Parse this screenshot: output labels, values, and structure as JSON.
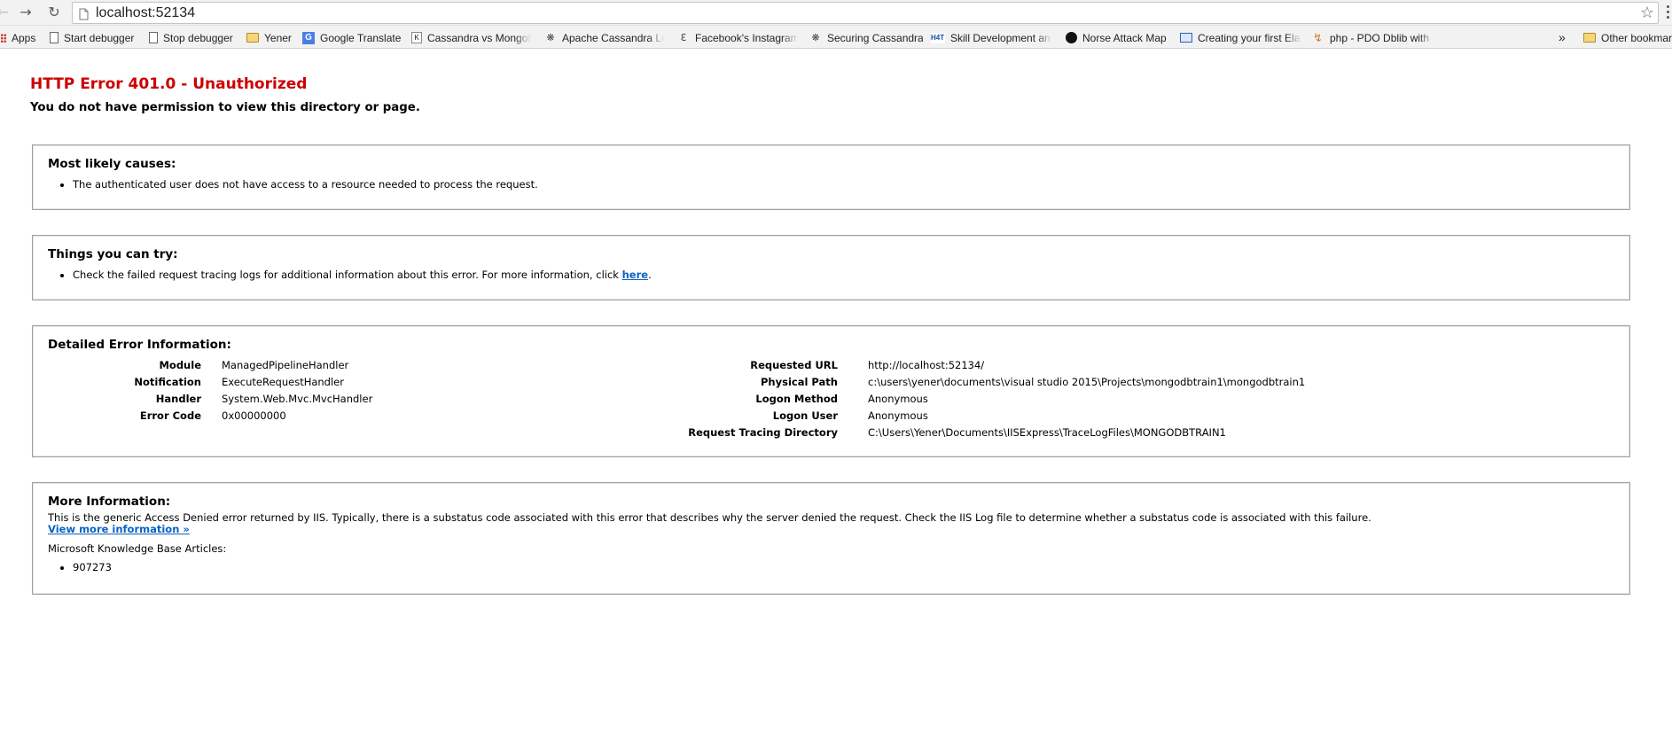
{
  "browser": {
    "address": "localhost:52134",
    "bookmarks": [
      {
        "label": "Apps",
        "icon": "apps-grid-icon"
      },
      {
        "label": "Start debugger",
        "icon": "page-icon"
      },
      {
        "label": "Stop debugger",
        "icon": "page-icon"
      },
      {
        "label": "Yener",
        "icon": "folder-icon"
      },
      {
        "label": "Google Translate",
        "icon": "google-translate-icon"
      },
      {
        "label": "Cassandra vs MongoD",
        "icon": "site-k-icon"
      },
      {
        "label": "Apache Cassandra Le",
        "icon": "cassandra-eye-icon"
      },
      {
        "label": "Facebook's Instagram",
        "icon": "site-e-icon"
      },
      {
        "label": "Securing Cassandra",
        "icon": "cassandra-eye-icon"
      },
      {
        "label": "Skill Development an",
        "icon": "h4-icon"
      },
      {
        "label": "Norse Attack Map",
        "icon": "norse-icon"
      },
      {
        "label": "Creating your first Ela",
        "icon": "book-icon"
      },
      {
        "label": "php - PDO Dblib with",
        "icon": "php-icon"
      }
    ],
    "overflow": "»",
    "other_bookmarks": "Other bookmarks"
  },
  "error": {
    "title": "HTTP Error 401.0 - Unauthorized",
    "subtitle": "You do not have permission to view this directory or page."
  },
  "causes": {
    "heading": "Most likely causes:",
    "items": [
      "The authenticated user does not have access to a resource needed to process the request."
    ]
  },
  "try": {
    "heading": "Things you can try:",
    "item_text": "Check the failed request tracing logs for additional information about this error. For more information, click ",
    "link": "here",
    "item_end": "."
  },
  "details": {
    "heading": "Detailed Error Information:",
    "left": [
      {
        "label": "Module",
        "value": "ManagedPipelineHandler"
      },
      {
        "label": "Notification",
        "value": "ExecuteRequestHandler"
      },
      {
        "label": "Handler",
        "value": "System.Web.Mvc.MvcHandler"
      },
      {
        "label": "Error Code",
        "value": "0x00000000"
      }
    ],
    "right": [
      {
        "label": "Requested URL",
        "value": "http://localhost:52134/"
      },
      {
        "label": "Physical Path",
        "value": "c:\\users\\yener\\documents\\visual studio 2015\\Projects\\mongodbtrain1\\mongodbtrain1"
      },
      {
        "label": "Logon Method",
        "value": "Anonymous"
      },
      {
        "label": "Logon User",
        "value": "Anonymous"
      },
      {
        "label": "Request Tracing Directory",
        "value": "C:\\Users\\Yener\\Documents\\IISExpress\\TraceLogFiles\\MONGODBTRAIN1"
      }
    ]
  },
  "more": {
    "heading": "More Information:",
    "text": "This is the generic Access Denied error returned by IIS. Typically, there is a substatus code associated with this error that describes why the server denied the request. Check the IIS Log file to determine whether a substatus code is associated with this failure.",
    "link": "View more information »",
    "kb_label": "Microsoft Knowledge Base Articles:",
    "kb_items": [
      "907273"
    ]
  },
  "colors": {
    "error_title": "#cc0000",
    "link": "#0a62c2"
  }
}
